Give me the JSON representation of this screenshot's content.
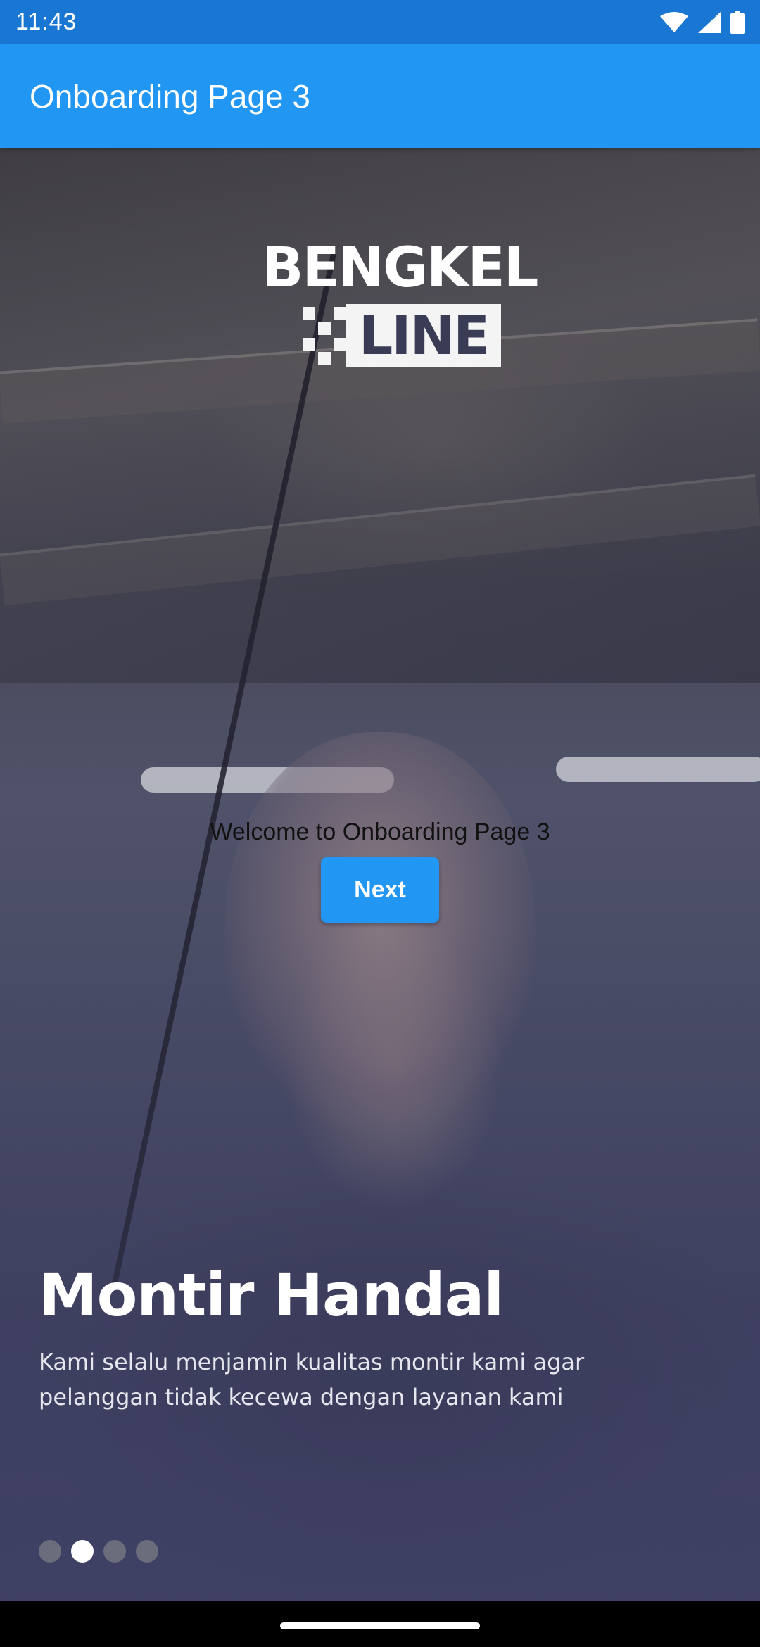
{
  "status_bar": {
    "time": "11:43",
    "icons": [
      "wifi-icon",
      "signal-icon",
      "battery-icon"
    ]
  },
  "app_bar": {
    "title": "Onboarding Page 3",
    "color": "#2196F3"
  },
  "logo": {
    "line1": "BENGKEL",
    "line2": "LINE"
  },
  "content": {
    "welcome_text": "Welcome to Onboarding Page 3",
    "next_label": "Next",
    "headline": "Montir Handal",
    "subtitle": "Kami selalu menjamin kualitas montir kami agar pelanggan tidak kecewa dengan layanan kami"
  },
  "page_indicator": {
    "count": 4,
    "active_index": 1
  }
}
